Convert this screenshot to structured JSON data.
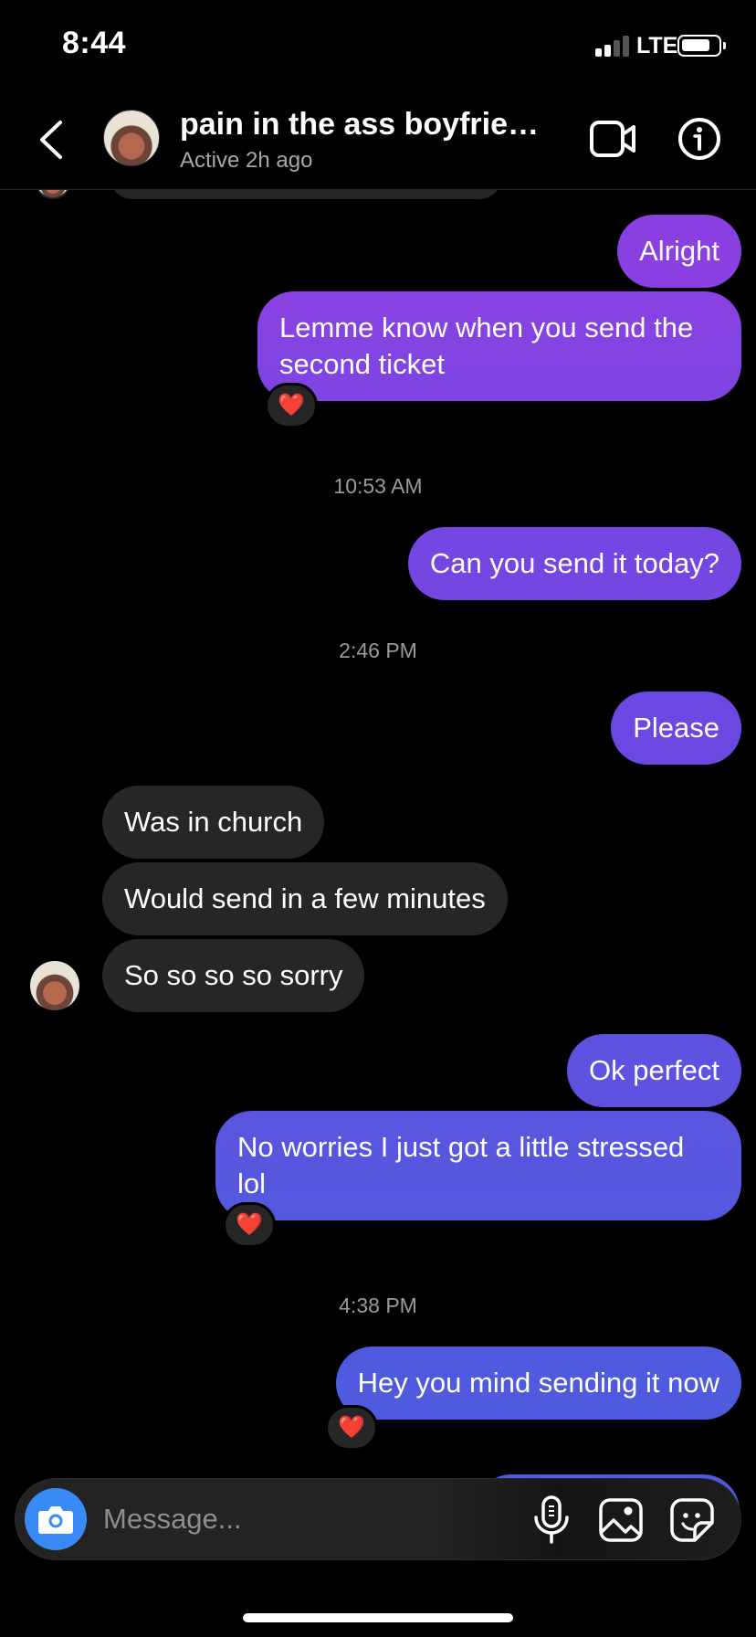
{
  "status_bar": {
    "time": "8:44",
    "network": "LTE"
  },
  "header": {
    "back_icon": "chevron-left-icon",
    "contact_name": "pain in the ass boyfriend...",
    "status": "Active 2h ago",
    "video_icon": "video-camera-icon",
    "info_icon": "info-icon"
  },
  "messages": [
    {
      "from": "me",
      "text": "Alright"
    },
    {
      "from": "me",
      "text": "Lemme know when you send the second ticket",
      "reaction": "❤️"
    },
    {
      "timestamp": "10:53 AM"
    },
    {
      "from": "me",
      "text": "Can you send it today?"
    },
    {
      "timestamp": "2:46 PM"
    },
    {
      "from": "me",
      "text": "Please"
    },
    {
      "from": "them",
      "text": "Was in church"
    },
    {
      "from": "them",
      "text": "Would send in a few minutes"
    },
    {
      "from": "them",
      "text": "So so so so sorry"
    },
    {
      "from": "me",
      "text": "Ok perfect"
    },
    {
      "from": "me",
      "text": "No worries I just got a little stressed lol",
      "reaction": "❤️"
    },
    {
      "timestamp": "4:38 PM"
    },
    {
      "from": "me",
      "text": "Hey you mind sending it now",
      "reaction": "❤️"
    }
  ],
  "composer": {
    "placeholder": "Message...",
    "camera_icon": "camera-icon",
    "mic_icon": "microphone-icon",
    "gallery_icon": "gallery-icon",
    "sticker_icon": "sticker-icon"
  },
  "colors": {
    "background": "#000000",
    "incoming_bubble": "#262626",
    "outgoing_gradient_top": "#8a3fe0",
    "outgoing_gradient_bottom": "#4e5bdc",
    "camera_button": "#3a8af5",
    "secondary_text": "#a8a8a8"
  }
}
